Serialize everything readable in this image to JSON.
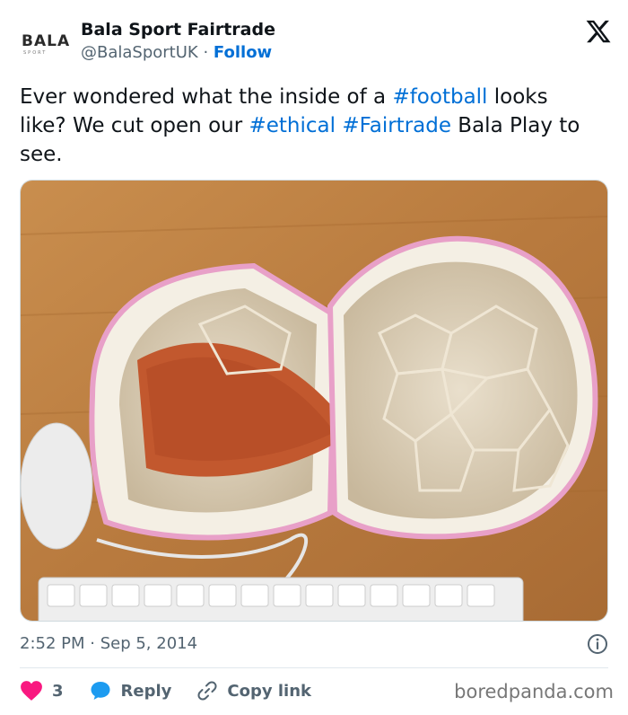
{
  "author": {
    "display_name": "Bala Sport Fairtrade",
    "handle": "@BalaSportUK",
    "separator": "·",
    "follow_label": "Follow",
    "avatar_text": "BALA",
    "avatar_subtext": "SPORT"
  },
  "tweet": {
    "segments": [
      {
        "text": "Ever wondered what the inside of a ",
        "hashtag": false
      },
      {
        "text": "#football",
        "hashtag": true
      },
      {
        "text": " looks like? We cut open our ",
        "hashtag": false
      },
      {
        "text": "#ethical",
        "hashtag": true
      },
      {
        "text": " ",
        "hashtag": false
      },
      {
        "text": "#Fairtrade",
        "hashtag": true
      },
      {
        "text": " Bala Play to see.",
        "hashtag": false
      }
    ]
  },
  "meta": {
    "timestamp": "2:52 PM · Sep 5, 2014"
  },
  "actions": {
    "like_count": "3",
    "reply_label": "Reply",
    "copy_label": "Copy link"
  },
  "watermark": "boredpanda.com",
  "icons": {
    "x_logo": "x-logo-icon",
    "info": "info-icon",
    "like": "heart-icon",
    "reply": "reply-bubble-icon",
    "copy": "link-icon"
  },
  "colors": {
    "link": "#006fd6",
    "heart": "#f91880",
    "reply": "#1d9bf0",
    "secondary": "#536471"
  }
}
